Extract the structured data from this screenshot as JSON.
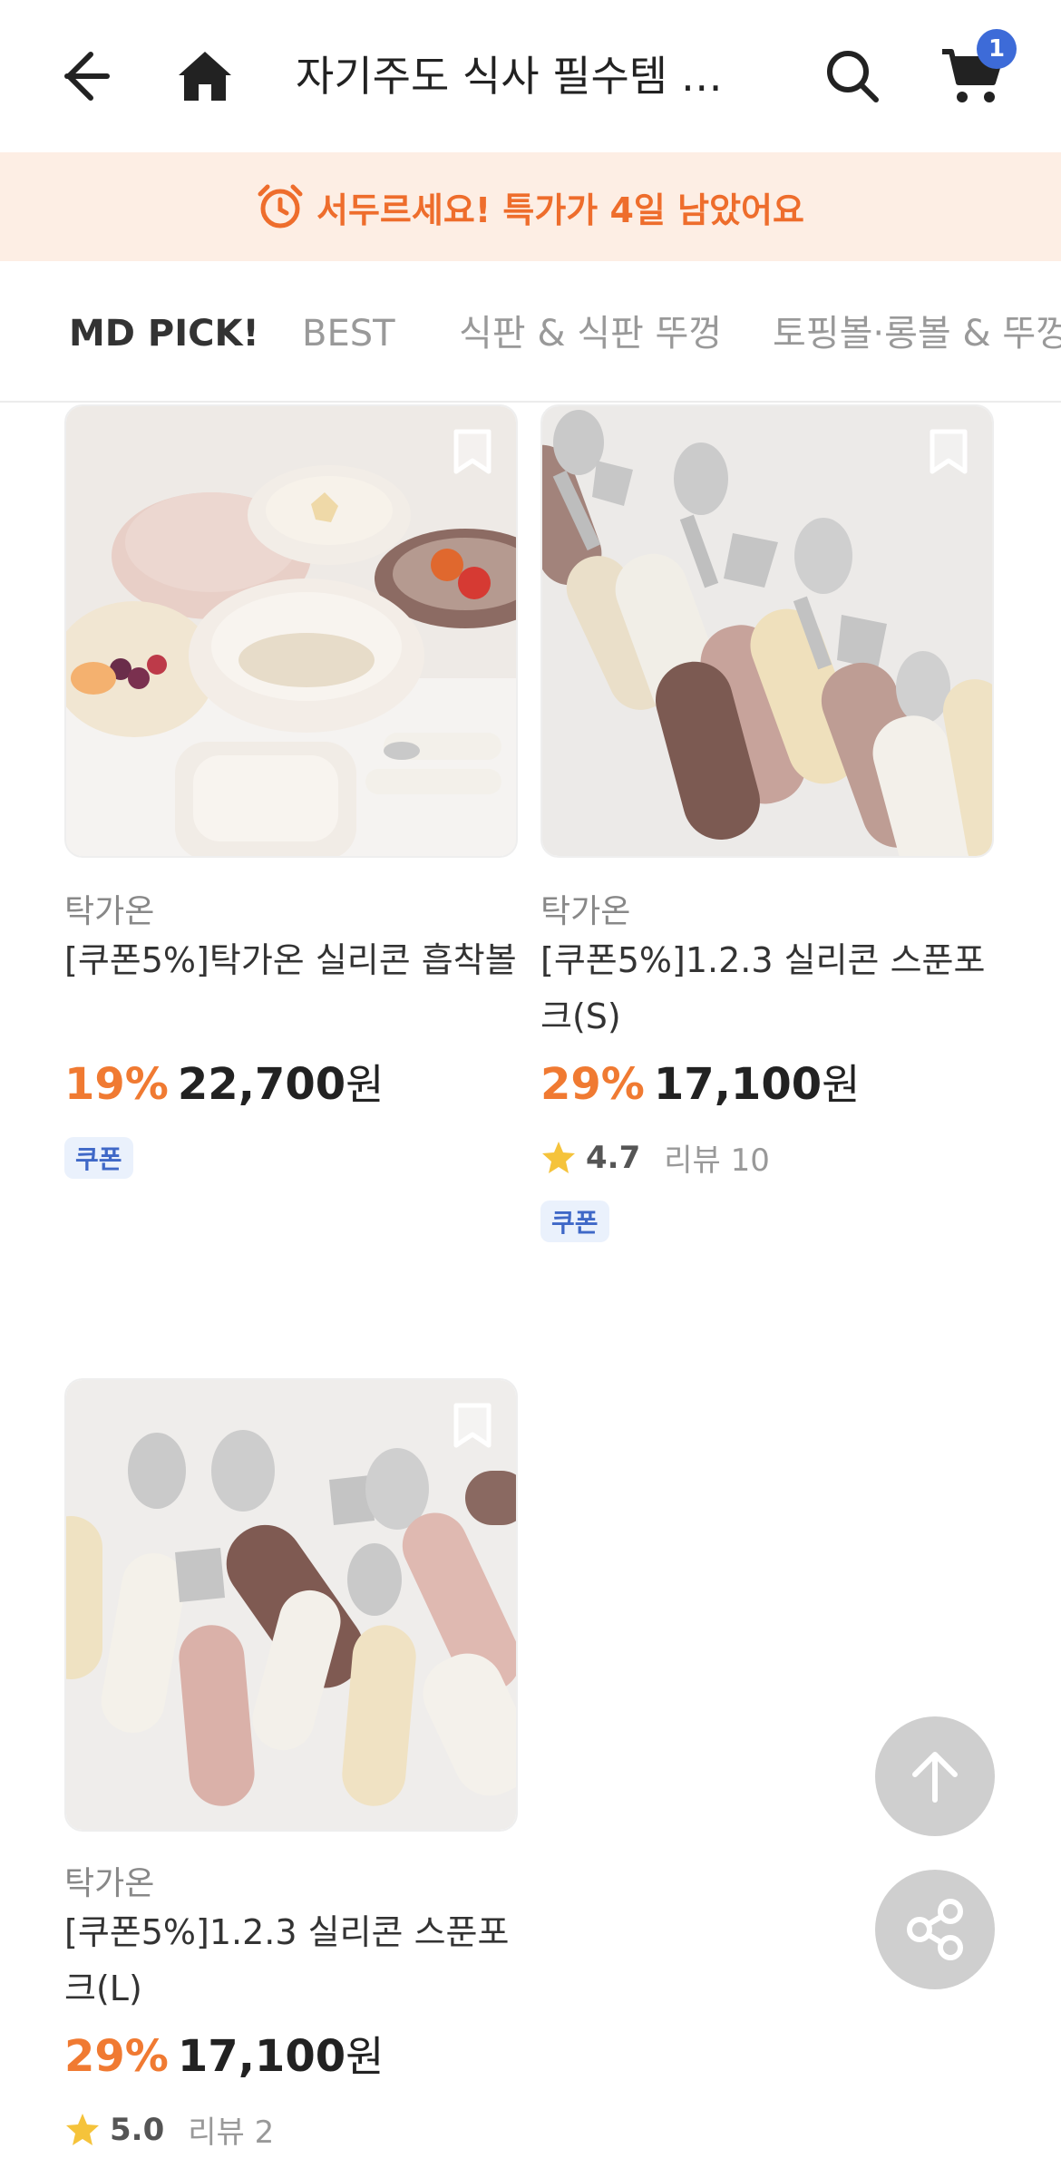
{
  "header": {
    "title": "자기주도 식사 필수템 …",
    "cart_count": "1"
  },
  "banner": {
    "text": "서두르세요! 특가가 4일 남았어요"
  },
  "tabs": [
    {
      "label": "MD PICK!",
      "active": true
    },
    {
      "label": "BEST",
      "active": false
    },
    {
      "label": "식판 & 식판 뚜껑",
      "active": false
    },
    {
      "label": "토핑볼·롱볼 & 뚜껑",
      "active": false
    }
  ],
  "products": [
    {
      "brand": "탁가온",
      "name": "[쿠폰5%]탁가온 실리콘 흡착볼",
      "discount": "19%",
      "price": "22,700",
      "currency": "원",
      "rating": "",
      "review": "",
      "coupon": "쿠폰"
    },
    {
      "brand": "탁가온",
      "name": "[쿠폰5%]1.2.3 실리콘 스푼포크(S)",
      "discount": "29%",
      "price": "17,100",
      "currency": "원",
      "rating": "4.7",
      "review": "리뷰 10",
      "coupon": "쿠폰"
    },
    {
      "brand": "탁가온",
      "name": "[쿠폰5%]1.2.3 실리콘 스푼포크(L)",
      "discount": "29%",
      "price": "17,100",
      "currency": "원",
      "rating": "5.0",
      "review": "리뷰 2",
      "coupon": ""
    }
  ],
  "colors": {
    "accent": "#ee6d2c",
    "discount": "#f07a32",
    "banner_bg": "#fdeee4",
    "badge": "#3d6bd8",
    "coupon_bg": "#eaf1fc",
    "coupon_text": "#3f68c7",
    "star": "#f5c33b"
  },
  "icons": {
    "back": "arrow-left-icon",
    "home": "home-icon",
    "search": "search-icon",
    "cart": "cart-icon",
    "alarm": "alarm-clock-icon",
    "bookmark": "bookmark-icon",
    "star": "star-icon",
    "scroll_top": "arrow-up-icon",
    "share": "share-icon"
  }
}
